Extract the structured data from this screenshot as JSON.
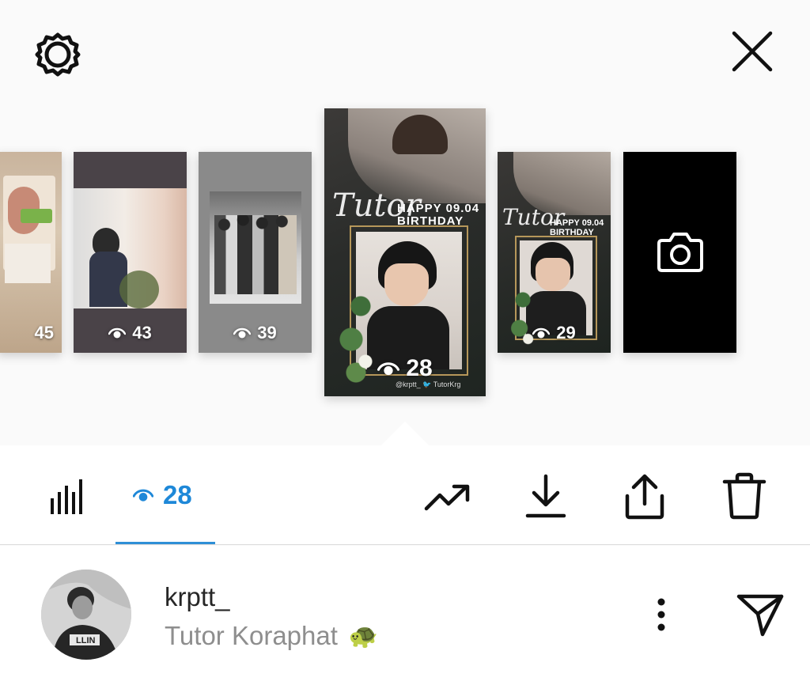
{
  "stories": [
    {
      "views": "45"
    },
    {
      "views": "43"
    },
    {
      "views": "39"
    },
    {
      "views": "28",
      "text_top": "HAPPY 09.04",
      "text_mid": "BIRTHDAY",
      "script": "Tutor",
      "credit": "@krptt_  🐦 TutorKrg"
    },
    {
      "views": "29",
      "text_top": "HAPPY 09.04",
      "text_mid": "BIRTHDAY",
      "script": "Tutor"
    }
  ],
  "selected": {
    "views": "28"
  },
  "viewer": {
    "username": "krptt_",
    "full_name": "Tutor Koraphat",
    "emoji": "🐢"
  },
  "icons": {
    "settings": "settings-gear-icon",
    "close": "close-icon",
    "camera": "camera-icon",
    "insights": "bar-chart-icon",
    "eye": "eye-icon",
    "promote": "trending-up-icon",
    "download": "download-icon",
    "share": "share-icon",
    "delete": "trash-icon",
    "more": "more-vertical-icon",
    "send": "send-icon"
  },
  "colors": {
    "accent": "#1e88d8",
    "text": "#262626",
    "secondary": "#8e8e8e"
  }
}
